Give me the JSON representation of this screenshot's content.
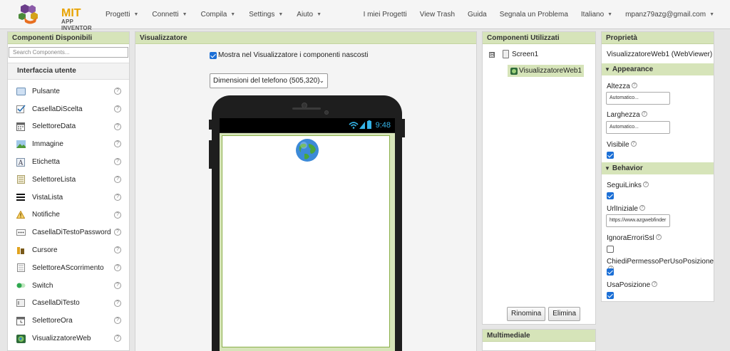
{
  "topbar": {
    "logo_mit": "MIT",
    "logo_sub": "APP INVENTOR",
    "menu_left": [
      "Progetti",
      "Connetti",
      "Compila",
      "Settings",
      "Aiuto"
    ],
    "menu_right": {
      "my_projects": "I miei Progetti",
      "view_trash": "View Trash",
      "guide": "Guida",
      "report": "Segnala un Problema",
      "language": "Italiano",
      "account": "mpanz79azg@gmail.com"
    }
  },
  "palette": {
    "title": "Componenti Disponibili",
    "search_placeholder": "Search Components...",
    "category": "Interfaccia utente",
    "items": [
      {
        "label": "Pulsante",
        "icon": "button-icon"
      },
      {
        "label": "CasellaDiScelta",
        "icon": "checkbox-icon"
      },
      {
        "label": "SelettoreData",
        "icon": "calendar-icon"
      },
      {
        "label": "Immagine",
        "icon": "image-icon"
      },
      {
        "label": "Etichetta",
        "icon": "label-icon"
      },
      {
        "label": "SelettoreLista",
        "icon": "listpicker-icon"
      },
      {
        "label": "VistaLista",
        "icon": "listview-icon"
      },
      {
        "label": "Notifiche",
        "icon": "warning-icon"
      },
      {
        "label": "CasellaDiTestoPassword",
        "icon": "password-icon"
      },
      {
        "label": "Cursore",
        "icon": "slider-icon"
      },
      {
        "label": "SelettoreAScorrimento",
        "icon": "spinner-icon"
      },
      {
        "label": "Switch",
        "icon": "switch-icon"
      },
      {
        "label": "CasellaDiTesto",
        "icon": "textbox-icon"
      },
      {
        "label": "SelettoreOra",
        "icon": "clock-icon"
      },
      {
        "label": "VisualizzatoreWeb",
        "icon": "webviewer-icon"
      }
    ]
  },
  "viewer": {
    "title": "Visualizzatore",
    "show_hidden_label": "Mostra nel Visualizzatore i componenti nascosti",
    "show_hidden_checked": true,
    "phone_size": "Dimensioni del telefono (505,320)",
    "clock": "9:48"
  },
  "components": {
    "title": "Componenti Utilizzati",
    "collapse_symbol": "⊟",
    "screen": "Screen1",
    "selected": "VisualizzatoreWeb1",
    "rename": "Rinomina",
    "delete": "Elimina",
    "media_title": "Multimediale"
  },
  "properties": {
    "title": "Proprietà",
    "component": "VisualizzatoreWeb1 (WebViewer)",
    "sections": {
      "appearance": "Appearance",
      "behavior": "Behavior"
    },
    "height_label": "Altezza",
    "height_value": "Automatico...",
    "width_label": "Larghezza",
    "width_value": "Automatico...",
    "visible_label": "Visibile",
    "visible": true,
    "follow_links_label": "SeguiLinks",
    "follow_links": true,
    "home_url_label": "UrlIniziale",
    "home_url_value": "https://www.azgwebfinder",
    "ignore_ssl_label": "IgnoraErroriSsl",
    "ignore_ssl": false,
    "prompt_geo_label": "ChiediPermessoPerUsoPosizione",
    "prompt_geo": true,
    "use_geo_label": "UsaPosizione",
    "use_geo": true
  }
}
